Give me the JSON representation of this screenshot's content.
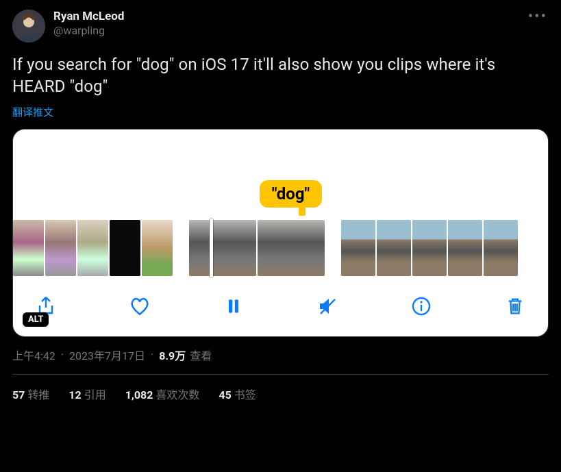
{
  "author": {
    "display_name": "Ryan McLeod",
    "handle": "@warpling"
  },
  "tweet_text": "If you search for \"dog\" on iOS 17 it'll also show you clips where it's HEARD \"dog\"",
  "translate_label": "翻译推文",
  "media": {
    "tooltip": "\"dog\"",
    "alt_badge": "ALT",
    "toolbar_icons": [
      "share-icon",
      "heart-icon",
      "pause-icon",
      "mute-icon",
      "info-icon",
      "trash-icon"
    ]
  },
  "meta": {
    "time": "上午4:42",
    "date": "2023年7月17日",
    "views_number": "8.9万",
    "views_label": "查看"
  },
  "stats": {
    "retweets_num": "57",
    "retweets_label": "转推",
    "quotes_num": "12",
    "quotes_label": "引用",
    "likes_num": "1,082",
    "likes_label": "喜欢次数",
    "bookmarks_num": "45",
    "bookmarks_label": "书签"
  }
}
